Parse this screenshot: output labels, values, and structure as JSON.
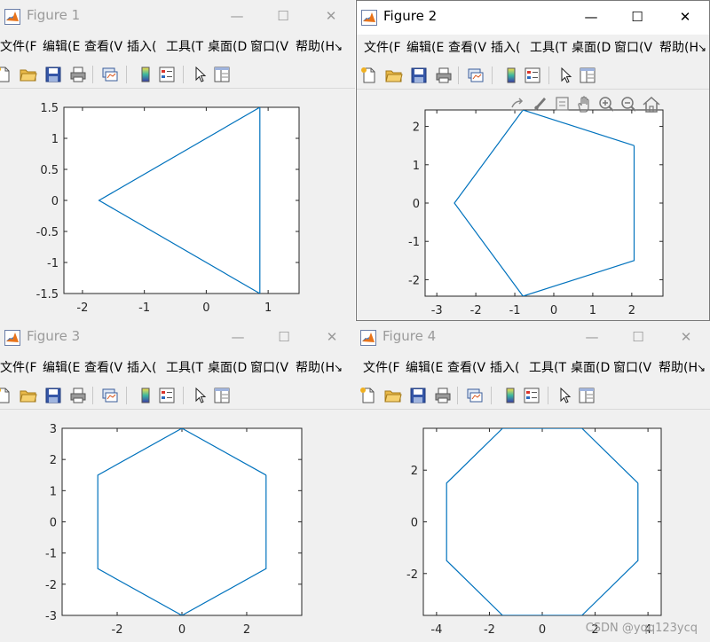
{
  "windows": [
    {
      "title": "Figure 1",
      "active": false,
      "menu": [
        "文件(F",
        "编辑(E",
        "查看(V",
        "插入(",
        "工具(T",
        "桌面(D",
        "窗口(V",
        "帮助(H"
      ],
      "x_ticks": [
        "-2",
        "-1",
        "0",
        "1"
      ],
      "y_ticks": [
        "1.5",
        "1",
        "0.5",
        "0",
        "-0.5",
        "-1",
        "-1.5"
      ],
      "chart_data": {
        "type": "line",
        "xlim": [
          -2.3,
          1.5
        ],
        "ylim": [
          -1.5,
          1.5
        ],
        "x": [
          0.866,
          -1.732,
          0.866,
          0.866
        ],
        "y": [
          1.5,
          0,
          -1.5,
          1.5
        ]
      }
    },
    {
      "title": "Figure 2",
      "active": true,
      "menu": [
        "文件(F",
        "编辑(E",
        "查看(V",
        "插入(",
        "工具(T",
        "桌面(D",
        "窗口(V",
        "帮助(H"
      ],
      "x_ticks": [
        "-3",
        "-2",
        "-1",
        "0",
        "1",
        "2"
      ],
      "y_ticks": [
        "2",
        "1",
        "0",
        "-1",
        "-2"
      ],
      "chart_data": {
        "type": "line",
        "xlim": [
          -3.3,
          2.8
        ],
        "ylim": [
          -2.43,
          2.43
        ],
        "x": [
          2.06,
          -0.79,
          -2.55,
          -0.79,
          2.06,
          2.06
        ],
        "y": [
          1.5,
          2.43,
          0,
          -2.43,
          -1.5,
          1.5
        ]
      }
    },
    {
      "title": "Figure 3",
      "active": false,
      "menu": [
        "文件(F",
        "编辑(E",
        "查看(V",
        "插入(",
        "工具(T",
        "桌面(D",
        "窗口(V",
        "帮助(H"
      ],
      "x_ticks": [
        "-2",
        "0",
        "2"
      ],
      "y_ticks": [
        "3",
        "2",
        "1",
        "0",
        "-1",
        "-2",
        "-3"
      ],
      "chart_data": {
        "type": "line",
        "xlim": [
          -3.7,
          3.7
        ],
        "ylim": [
          -3,
          3
        ],
        "x": [
          2.598,
          0,
          -2.598,
          -2.598,
          0,
          2.598,
          2.598
        ],
        "y": [
          1.5,
          3,
          1.5,
          -1.5,
          -3,
          -1.5,
          1.5
        ]
      }
    },
    {
      "title": "Figure 4",
      "active": false,
      "menu": [
        "文件(F",
        "编辑(E",
        "查看(V",
        "插入(",
        "工具(T",
        "桌面(D",
        "窗口(V",
        "帮助(H"
      ],
      "x_ticks": [
        "-4",
        "-2",
        "0",
        "2",
        "4"
      ],
      "y_ticks": [
        "2",
        "0",
        "-2"
      ],
      "chart_data": {
        "type": "line",
        "xlim": [
          -4.5,
          4.5
        ],
        "ylim": [
          -3.62,
          3.62
        ],
        "x": [
          3.62,
          1.5,
          -1.5,
          -3.62,
          -3.62,
          -1.5,
          1.5,
          3.62,
          3.62
        ],
        "y": [
          1.5,
          3.62,
          3.62,
          1.5,
          -1.5,
          -3.62,
          -3.62,
          -1.5,
          1.5
        ]
      }
    }
  ],
  "watermark": "CSDN @yqq123ycq",
  "colors": {
    "line": "#0072bd",
    "bg": "#f0f0f0",
    "axes_bg": "#ffffff"
  }
}
